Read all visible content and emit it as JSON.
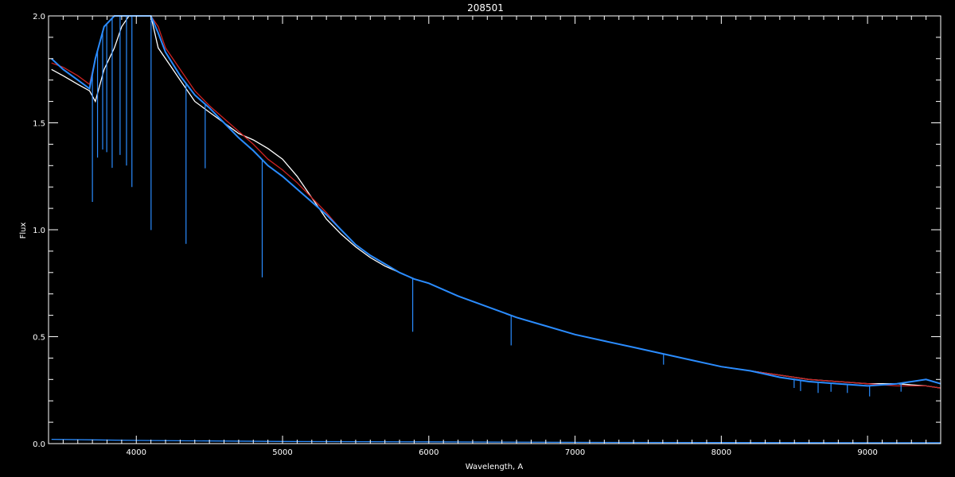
{
  "chart_data": {
    "type": "line",
    "title": "208501",
    "xlabel": "Wavelength, A",
    "ylabel": "Flux",
    "xlim": [
      3400,
      9500
    ],
    "ylim": [
      0.0,
      2.0
    ],
    "x_ticks": [
      {
        "value": 4000,
        "label": "4000"
      },
      {
        "value": 5000,
        "label": "5000"
      },
      {
        "value": 6000,
        "label": "6000"
      },
      {
        "value": 7000,
        "label": "7000"
      },
      {
        "value": 8000,
        "label": "8000"
      },
      {
        "value": 9000,
        "label": "9000"
      }
    ],
    "y_ticks": [
      {
        "value": 0.0,
        "label": "0.0"
      },
      {
        "value": 0.5,
        "label": "0.5"
      },
      {
        "value": 1.0,
        "label": "1.0"
      },
      {
        "value": 1.5,
        "label": "1.5"
      },
      {
        "value": 2.0,
        "label": "2.0"
      }
    ],
    "grid": false,
    "background": "#000000",
    "series": [
      {
        "color": "#ffffff",
        "x": [
          3420,
          3500,
          3600,
          3680,
          3720,
          3780,
          3850,
          3900,
          3950,
          4000,
          4050,
          4100,
          4150,
          4200,
          4300,
          4400,
          4500,
          4600,
          4700,
          4800,
          4900,
          5000,
          5100,
          5200,
          5300,
          5400,
          5500,
          5600,
          5700,
          5800,
          5900,
          6000,
          6200,
          6400,
          6600,
          6800,
          7000,
          7200,
          7400,
          7600,
          7800,
          8000,
          8200,
          8400,
          8600,
          8800,
          9000,
          9200,
          9400,
          9500
        ],
        "y": [
          1.75,
          1.72,
          1.68,
          1.65,
          1.6,
          1.75,
          1.85,
          1.95,
          2.0,
          2.0,
          2.0,
          2.0,
          1.85,
          1.8,
          1.7,
          1.6,
          1.55,
          1.5,
          1.45,
          1.42,
          1.38,
          1.33,
          1.25,
          1.15,
          1.05,
          0.98,
          0.92,
          0.87,
          0.83,
          0.8,
          0.77,
          0.75,
          0.69,
          0.64,
          0.59,
          0.55,
          0.51,
          0.48,
          0.45,
          0.42,
          0.39,
          0.36,
          0.34,
          0.32,
          0.3,
          0.29,
          0.28,
          0.28,
          0.27,
          0.26
        ]
      },
      {
        "color": "#cc2222",
        "x": [
          3420,
          3500,
          3600,
          3680,
          3720,
          3780,
          3850,
          3900,
          3950,
          4000,
          4050,
          4100,
          4150,
          4200,
          4300,
          4400,
          4500,
          4600,
          4700,
          4800,
          4900,
          5000,
          5100,
          5200,
          5300,
          5400,
          5500,
          5600,
          5700,
          5800,
          5900,
          6000,
          6200,
          6400,
          6600,
          6800,
          7000,
          7200,
          7400,
          7600,
          7800,
          8000,
          8200,
          8400,
          8600,
          8800,
          9000,
          9200,
          9400,
          9500
        ],
        "y": [
          1.78,
          1.76,
          1.72,
          1.68,
          1.8,
          1.95,
          2.0,
          2.0,
          2.0,
          2.0,
          2.0,
          2.0,
          1.95,
          1.85,
          1.75,
          1.65,
          1.58,
          1.52,
          1.46,
          1.4,
          1.33,
          1.28,
          1.22,
          1.15,
          1.08,
          1.0,
          0.93,
          0.88,
          0.84,
          0.8,
          0.77,
          0.75,
          0.69,
          0.64,
          0.59,
          0.55,
          0.51,
          0.48,
          0.45,
          0.42,
          0.39,
          0.36,
          0.34,
          0.32,
          0.3,
          0.29,
          0.28,
          0.27,
          0.27,
          0.26
        ]
      },
      {
        "color": "#2a8cff",
        "x": [
          3420,
          3500,
          3600,
          3680,
          3720,
          3780,
          3850,
          3900,
          3950,
          4000,
          4050,
          4100,
          4150,
          4200,
          4300,
          4400,
          4500,
          4600,
          4700,
          4800,
          4900,
          5000,
          5100,
          5200,
          5300,
          5400,
          5500,
          5600,
          5700,
          5800,
          5900,
          6000,
          6200,
          6400,
          6600,
          6800,
          7000,
          7200,
          7400,
          7600,
          7800,
          8000,
          8200,
          8400,
          8600,
          8800,
          9000,
          9200,
          9400,
          9500
        ],
        "y": [
          1.8,
          1.75,
          1.7,
          1.66,
          1.8,
          1.95,
          2.0,
          2.0,
          2.0,
          2.0,
          2.0,
          2.0,
          1.92,
          1.83,
          1.72,
          1.63,
          1.57,
          1.5,
          1.43,
          1.37,
          1.3,
          1.25,
          1.19,
          1.13,
          1.07,
          1.0,
          0.93,
          0.88,
          0.84,
          0.8,
          0.77,
          0.75,
          0.69,
          0.64,
          0.59,
          0.55,
          0.51,
          0.48,
          0.45,
          0.42,
          0.39,
          0.36,
          0.34,
          0.31,
          0.29,
          0.28,
          0.27,
          0.28,
          0.3,
          0.28
        ]
      },
      {
        "color": "#2a8cff",
        "x": [
          3420,
          4000,
          5000,
          6000,
          7000,
          8000,
          9000,
          9500
        ],
        "y": [
          0.02,
          0.015,
          0.01,
          0.008,
          0.006,
          0.005,
          0.004,
          0.004
        ]
      }
    ],
    "absorption_lines": [
      {
        "x": 3700,
        "depth": 0.6,
        "color": "#2a8cff"
      },
      {
        "x": 3735,
        "depth": 0.5,
        "color": "#2a8cff"
      },
      {
        "x": 3770,
        "depth": 0.55,
        "color": "#2a8cff"
      },
      {
        "x": 3798,
        "depth": 0.6,
        "color": "#2a8cff"
      },
      {
        "x": 3835,
        "depth": 0.7,
        "color": "#2a8cff"
      },
      {
        "x": 3889,
        "depth": 0.65,
        "color": "#2a8cff"
      },
      {
        "x": 3933,
        "depth": 0.7,
        "color": "#2a8cff"
      },
      {
        "x": 3970,
        "depth": 0.8,
        "color": "#2a8cff"
      },
      {
        "x": 4101,
        "depth": 1.0,
        "color": "#2a8cff"
      },
      {
        "x": 4340,
        "depth": 0.75,
        "color": "#2a8cff"
      },
      {
        "x": 4471,
        "depth": 0.3,
        "color": "#2a8cff"
      },
      {
        "x": 4861,
        "depth": 0.55,
        "color": "#2a8cff"
      },
      {
        "x": 5890,
        "depth": 0.25,
        "color": "#2a8cff"
      },
      {
        "x": 6563,
        "depth": 0.14,
        "color": "#2a8cff"
      },
      {
        "x": 7605,
        "depth": 0.05,
        "color": "#2a8cff"
      },
      {
        "x": 8498,
        "depth": 0.04,
        "color": "#2a8cff"
      },
      {
        "x": 8542,
        "depth": 0.05,
        "color": "#2a8cff"
      },
      {
        "x": 8662,
        "depth": 0.05,
        "color": "#2a8cff"
      },
      {
        "x": 8750,
        "depth": 0.04,
        "color": "#2a8cff"
      },
      {
        "x": 8862,
        "depth": 0.04,
        "color": "#2a8cff"
      },
      {
        "x": 9014,
        "depth": 0.05,
        "color": "#2a8cff"
      },
      {
        "x": 9229,
        "depth": 0.04,
        "color": "#2a8cff"
      }
    ]
  }
}
